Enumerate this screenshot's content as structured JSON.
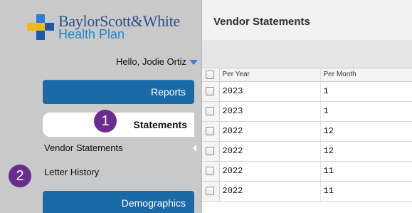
{
  "brand": {
    "name": "BaylorScott&White",
    "sub": "Health Plan",
    "colors": {
      "blue": "#2b4f86",
      "light_blue": "#1f88c9",
      "cross_gold": "#f3b71b",
      "cross_blue": "#1a5aa8"
    }
  },
  "user": {
    "greeting": "Hello, Jodie Ortiz"
  },
  "sidebar": {
    "reports_label": "Reports",
    "statements_label": "Statements",
    "nav_items": [
      "Vendor Statements",
      "Letter History"
    ],
    "demographics_label": "Demographics"
  },
  "badges": [
    "1",
    "2"
  ],
  "main": {
    "title": "Vendor Statements",
    "columns": [
      "Per Year",
      "Per Month"
    ],
    "rows": [
      {
        "year": "2023",
        "month": "1"
      },
      {
        "year": "2023",
        "month": "1"
      },
      {
        "year": "2022",
        "month": "12"
      },
      {
        "year": "2022",
        "month": "12"
      },
      {
        "year": "2022",
        "month": "11"
      },
      {
        "year": "2022",
        "month": "11"
      }
    ]
  },
  "accent": {
    "nav_blue": "#1b6aa8",
    "badge_purple": "#6a2c8e",
    "caret_blue": "#3a7fd0"
  }
}
